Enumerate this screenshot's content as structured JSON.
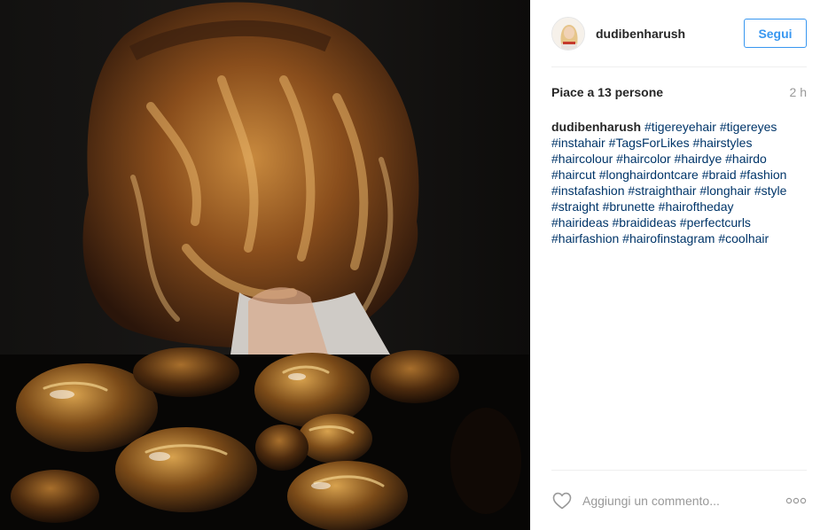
{
  "post": {
    "username": "dudibenharush",
    "follow_label": "Segui",
    "likes_text": "Piace a 13 persone",
    "time_ago": "2 h",
    "caption": {
      "user": "dudibenharush",
      "lines": [
        [
          "#tigereyehair",
          "#tigereyes"
        ],
        [
          "#instahair",
          "#TagsForLikes",
          "#hairstyles"
        ],
        [
          "#haircolour",
          "#haircolor",
          "#hairdye",
          "#hairdo"
        ],
        [
          "#haircut",
          "#longhairdontcare",
          "#braid",
          "#fashion"
        ],
        [
          "#instafashion",
          "#straighthair",
          "#longhair",
          "#style"
        ],
        [
          "#straight",
          "#brunette",
          "#hairoftheday"
        ],
        [
          "#hairideas",
          "#braidideas",
          "#perfectcurls"
        ],
        [
          "#hairfashion",
          "#hairofinstagram",
          "#coolhair"
        ]
      ]
    },
    "comment_placeholder": "Aggiungi un commento...",
    "icons": {
      "like": "heart-outline-icon",
      "more": "more-options-icon"
    },
    "colors": {
      "follow_blue": "#3897f0",
      "hashtag": "#003569",
      "muted": "#999999"
    }
  }
}
